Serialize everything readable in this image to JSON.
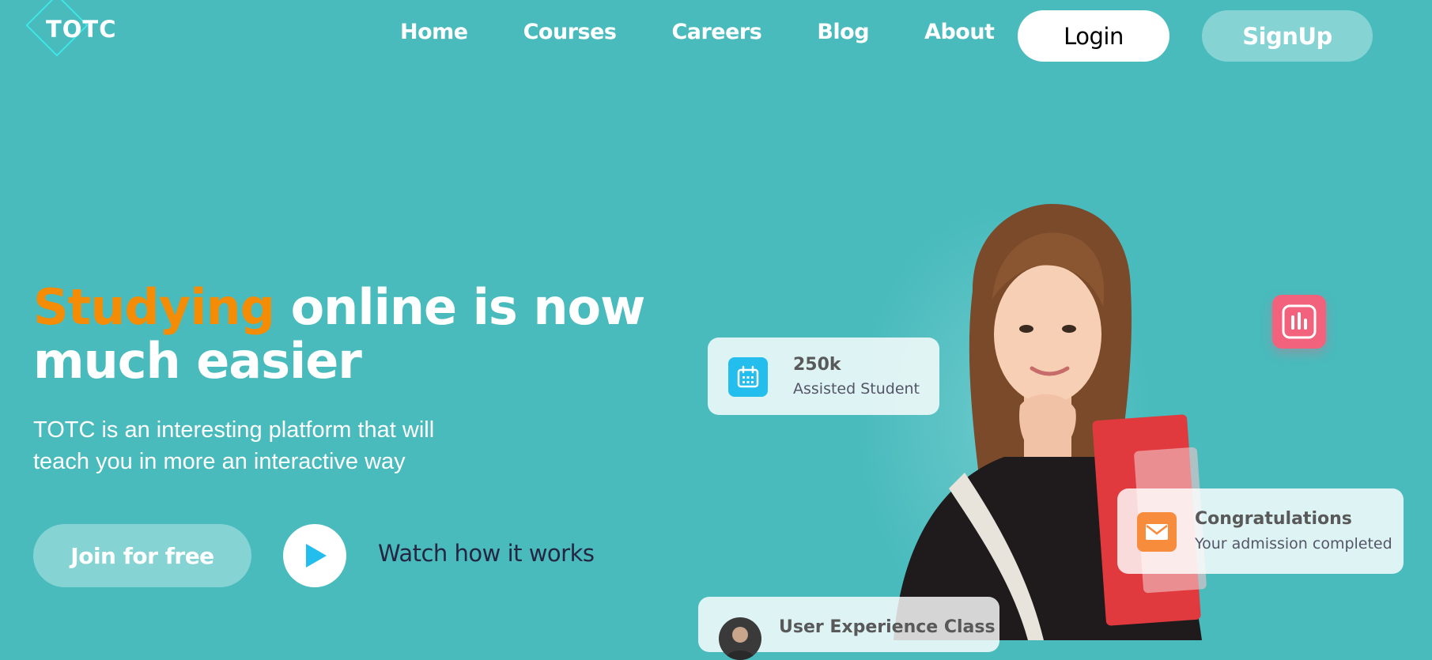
{
  "brand": {
    "logo_text": "TOTC"
  },
  "nav": {
    "items": [
      "Home",
      "Courses",
      "Careers",
      "Blog",
      "About"
    ],
    "login_label": "Login",
    "signup_label": "SignUp"
  },
  "hero": {
    "headline_accent": "Studying",
    "headline_rest_line1": " online is now",
    "headline_line2": "much easier",
    "subtext": "TOTC is an interesting platform that will teach you in more an interactive way",
    "join_label": "Join for free",
    "watch_label": "Watch how it works"
  },
  "cards": {
    "students": {
      "count": "250k",
      "label": "Assisted Student",
      "icon": "calendar-icon"
    },
    "congrats": {
      "title": "Congratulations",
      "label": "Your admission completed",
      "icon": "mail-icon"
    },
    "ux_class": {
      "title": "User Experience Class"
    },
    "badge": {
      "icon": "bar-chart-icon"
    }
  },
  "colors": {
    "background": "#49BBBD",
    "accent": "#F48C06",
    "signup_button": "#86D3D4",
    "calendar_icon_bg": "#23BDEE",
    "mail_icon_bg": "#F88C3D",
    "chart_badge_bg": "#F3627C"
  }
}
